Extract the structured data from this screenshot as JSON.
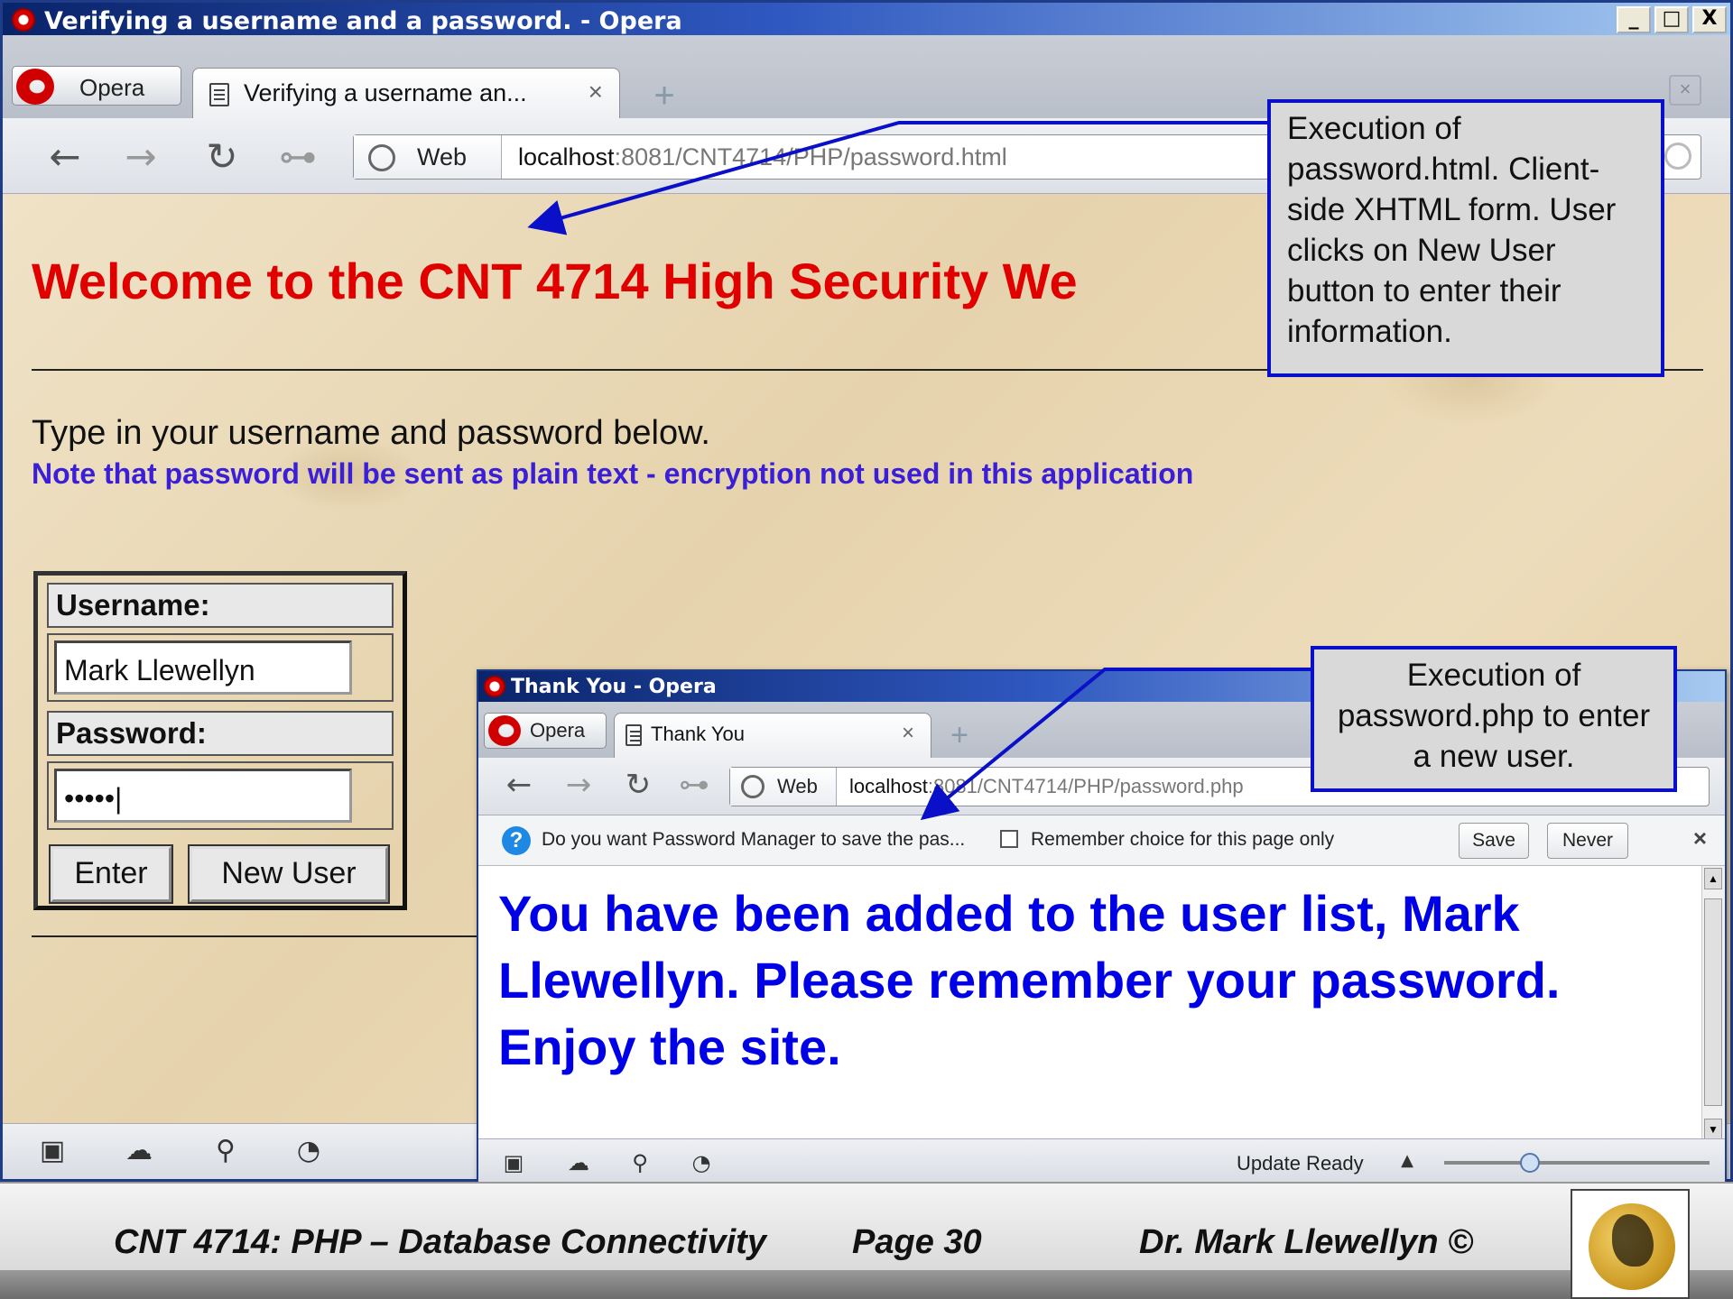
{
  "main_window": {
    "title": "Verifying a username and a password. - Opera",
    "opera_menu_label": "Opera",
    "tab_label": "Verifying a username an...",
    "tab_close": "×",
    "web_label": "Web",
    "url_host": "localhost",
    "url_rest": ":8081/CNT4714/PHP/password.html",
    "window_buttons": [
      "_",
      "□",
      "X"
    ]
  },
  "page": {
    "welcome": "Welcome to the CNT 4714 High Security We",
    "instruction": "Type in your username and password below.",
    "note": "Note that password will be sent as plain text - encryption not used in this application",
    "form": {
      "username_label": "Username:",
      "username_value": "Mark Llewellyn",
      "password_label": "Password:",
      "password_value": "•••••|",
      "enter_button": "Enter",
      "new_user_button": "New User"
    }
  },
  "second_window": {
    "title": "Thank You - Opera",
    "opera_menu_label": "Opera",
    "tab_label": "Thank You",
    "tab_close": "×",
    "web_label": "Web",
    "url_host": "localhost",
    "url_rest": ":8081/CNT4714/PHP/password.php",
    "password_prompt": "Do you want Password Manager to save the pas...",
    "remember_choice": "Remember choice for this page only",
    "save_button": "Save",
    "never_button": "Never",
    "close_bar": "×",
    "message": "You have been added to the user list, Mark Llewellyn. Please remember your password.",
    "enjoy": "Enjoy the site.",
    "status": "Update Ready"
  },
  "callouts": {
    "first": "Execution of password.html.  Client-side XHTML form.  User clicks on New User button to enter their information.",
    "second": "Execution of password.php to enter a new user."
  },
  "footer": {
    "course": "CNT 4714:  PHP – Database Connectivity",
    "page": "Page 30",
    "author": "Dr. Mark Llewellyn ©"
  },
  "colors": {
    "welcome_red": "#e00000",
    "note_blue": "#3a1ed8",
    "message_blue": "#0000e6",
    "callout_border": "#0a10c8"
  }
}
